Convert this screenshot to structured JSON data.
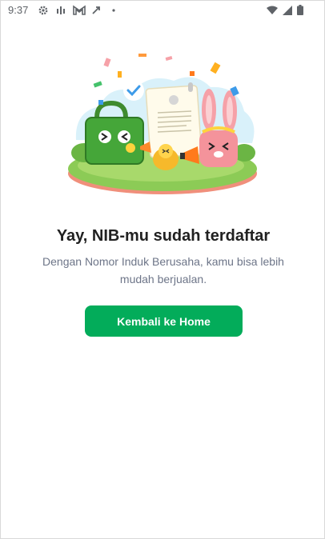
{
  "status_bar": {
    "time": "9:37",
    "left_icons": [
      "settings-icon",
      "signal-bars-icon",
      "gmail-icon",
      "sync-icon",
      "dot-icon"
    ],
    "right_icons": [
      "wifi-icon",
      "cellular-icon",
      "battery-icon"
    ]
  },
  "hero": {
    "illustration": "nib-registered-celebration-illustration"
  },
  "content": {
    "title": "Yay, NIB-mu sudah terdaftar",
    "subtitle": "Dengan Nomor Induk Berusaha, kamu bisa lebih mudah berjualan.",
    "button_label": "Kembali ke Home"
  },
  "colors": {
    "primary": "#03ac5a",
    "title": "#212121",
    "subtitle": "#6d7588"
  }
}
